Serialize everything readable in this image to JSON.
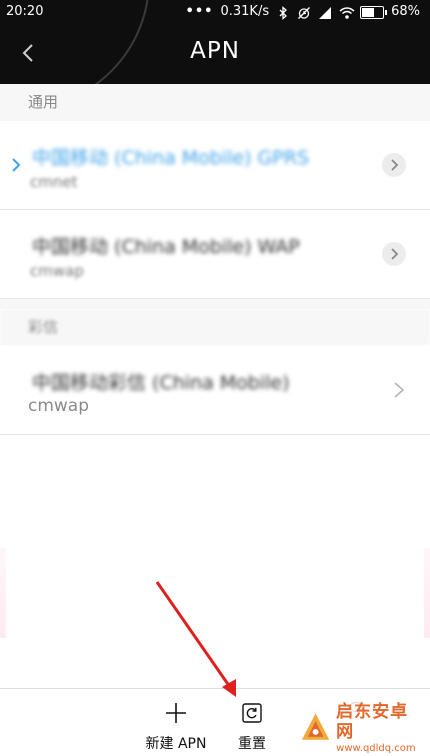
{
  "status_bar": {
    "time": "20:20",
    "dots": "•••",
    "net_speed": "0.31K/s",
    "battery_percent": "68%",
    "battery_level": 0.68,
    "icons": [
      "bluetooth-icon",
      "alarm-off-icon",
      "signal-icon",
      "wifi-icon",
      "battery-charging-icon"
    ]
  },
  "header": {
    "title": "APN",
    "back_icon": "chevron-left-icon"
  },
  "sections": [
    {
      "label": "通用",
      "items": [
        {
          "name": "中国移动 (China Mobile) GPRS",
          "sub": "cmnet",
          "selected": true,
          "action_icon": "chevron-circle-icon"
        },
        {
          "name": "中国移动 (China Mobile) WAP",
          "sub": "cmwap",
          "selected": false,
          "action_icon": "chevron-circle-icon"
        }
      ]
    },
    {
      "label": "彩信",
      "items": [
        {
          "name": "中国移动彩信 (China Mobile)",
          "sub": "cmwap",
          "selected": false,
          "action_icon": "chevron-right-icon"
        }
      ]
    }
  ],
  "bottom_bar": {
    "new_apn_label": "新建 APN",
    "reset_label": "重置",
    "new_icon": "plus-icon",
    "reset_icon": "reset-icon"
  },
  "watermark": {
    "name": "启东安卓网",
    "url": "www.qdldq.com"
  },
  "colors": {
    "accent": "#3ea2e8",
    "header_bg": "#0e0e0e",
    "annotation": "#e0201f",
    "watermark": "#e0682b"
  }
}
